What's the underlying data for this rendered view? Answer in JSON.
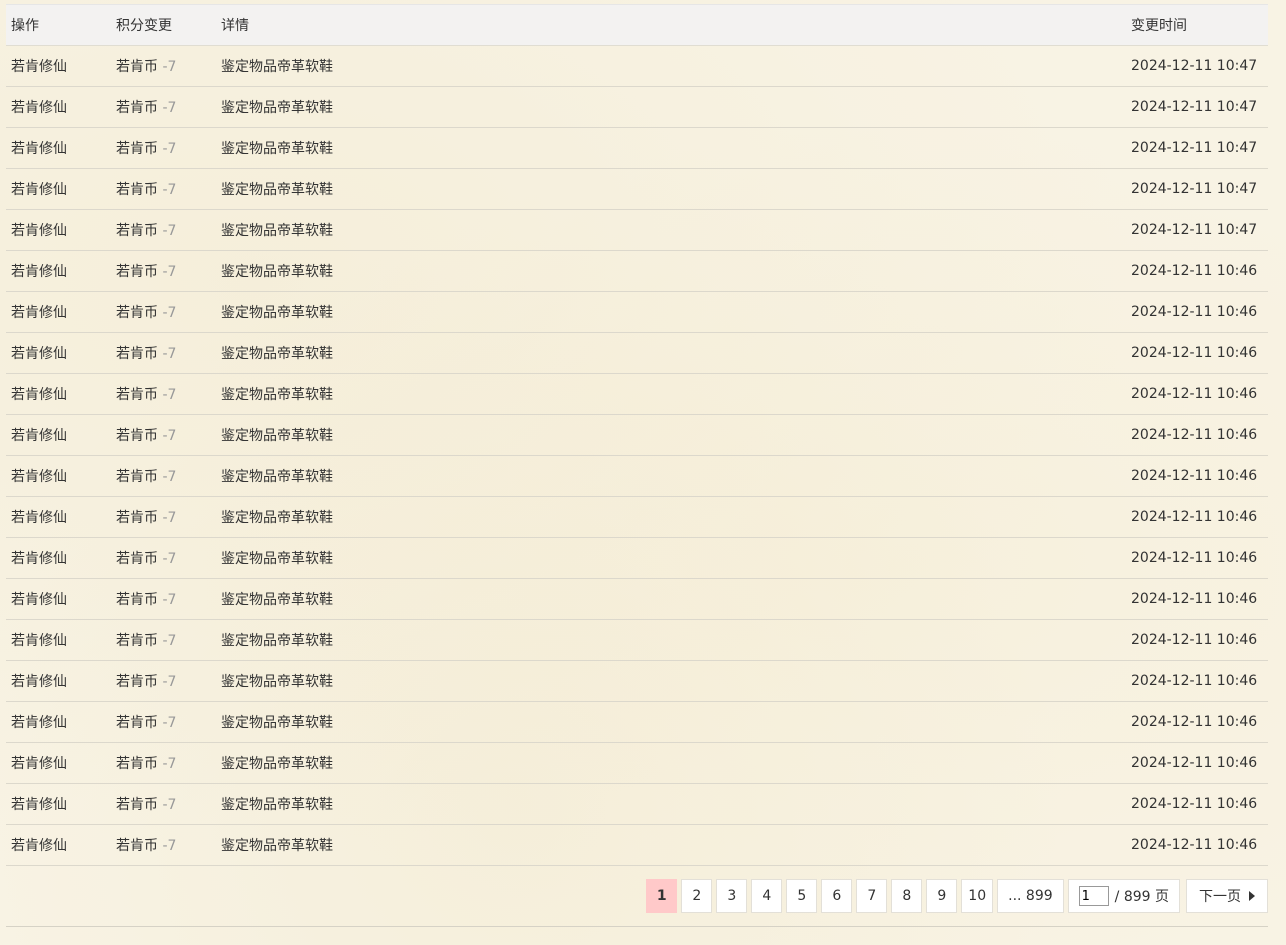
{
  "table": {
    "headers": {
      "op": "操作",
      "change": "积分变更",
      "detail": "详情",
      "time": "变更时间"
    },
    "rows": [
      {
        "op": "若肯修仙",
        "currency": "若肯币",
        "delta": "-7",
        "detail": "鉴定物品帝革软鞋",
        "time": "2024-12-11 10:47"
      },
      {
        "op": "若肯修仙",
        "currency": "若肯币",
        "delta": "-7",
        "detail": "鉴定物品帝革软鞋",
        "time": "2024-12-11 10:47"
      },
      {
        "op": "若肯修仙",
        "currency": "若肯币",
        "delta": "-7",
        "detail": "鉴定物品帝革软鞋",
        "time": "2024-12-11 10:47"
      },
      {
        "op": "若肯修仙",
        "currency": "若肯币",
        "delta": "-7",
        "detail": "鉴定物品帝革软鞋",
        "time": "2024-12-11 10:47"
      },
      {
        "op": "若肯修仙",
        "currency": "若肯币",
        "delta": "-7",
        "detail": "鉴定物品帝革软鞋",
        "time": "2024-12-11 10:47"
      },
      {
        "op": "若肯修仙",
        "currency": "若肯币",
        "delta": "-7",
        "detail": "鉴定物品帝革软鞋",
        "time": "2024-12-11 10:46"
      },
      {
        "op": "若肯修仙",
        "currency": "若肯币",
        "delta": "-7",
        "detail": "鉴定物品帝革软鞋",
        "time": "2024-12-11 10:46"
      },
      {
        "op": "若肯修仙",
        "currency": "若肯币",
        "delta": "-7",
        "detail": "鉴定物品帝革软鞋",
        "time": "2024-12-11 10:46"
      },
      {
        "op": "若肯修仙",
        "currency": "若肯币",
        "delta": "-7",
        "detail": "鉴定物品帝革软鞋",
        "time": "2024-12-11 10:46"
      },
      {
        "op": "若肯修仙",
        "currency": "若肯币",
        "delta": "-7",
        "detail": "鉴定物品帝革软鞋",
        "time": "2024-12-11 10:46"
      },
      {
        "op": "若肯修仙",
        "currency": "若肯币",
        "delta": "-7",
        "detail": "鉴定物品帝革软鞋",
        "time": "2024-12-11 10:46"
      },
      {
        "op": "若肯修仙",
        "currency": "若肯币",
        "delta": "-7",
        "detail": "鉴定物品帝革软鞋",
        "time": "2024-12-11 10:46"
      },
      {
        "op": "若肯修仙",
        "currency": "若肯币",
        "delta": "-7",
        "detail": "鉴定物品帝革软鞋",
        "time": "2024-12-11 10:46"
      },
      {
        "op": "若肯修仙",
        "currency": "若肯币",
        "delta": "-7",
        "detail": "鉴定物品帝革软鞋",
        "time": "2024-12-11 10:46"
      },
      {
        "op": "若肯修仙",
        "currency": "若肯币",
        "delta": "-7",
        "detail": "鉴定物品帝革软鞋",
        "time": "2024-12-11 10:46"
      },
      {
        "op": "若肯修仙",
        "currency": "若肯币",
        "delta": "-7",
        "detail": "鉴定物品帝革软鞋",
        "time": "2024-12-11 10:46"
      },
      {
        "op": "若肯修仙",
        "currency": "若肯币",
        "delta": "-7",
        "detail": "鉴定物品帝革软鞋",
        "time": "2024-12-11 10:46"
      },
      {
        "op": "若肯修仙",
        "currency": "若肯币",
        "delta": "-7",
        "detail": "鉴定物品帝革软鞋",
        "time": "2024-12-11 10:46"
      },
      {
        "op": "若肯修仙",
        "currency": "若肯币",
        "delta": "-7",
        "detail": "鉴定物品帝革软鞋",
        "time": "2024-12-11 10:46"
      },
      {
        "op": "若肯修仙",
        "currency": "若肯币",
        "delta": "-7",
        "detail": "鉴定物品帝革软鞋",
        "time": "2024-12-11 10:46"
      }
    ]
  },
  "pagination": {
    "current_page": "1",
    "pages": [
      "2",
      "3",
      "4",
      "5",
      "6",
      "7",
      "8",
      "9",
      "10"
    ],
    "last_page_label": "... 899",
    "jump_value": "1",
    "total_label": "/ 899 页",
    "next_label": "下一页"
  },
  "colors": {
    "current_page_bg": "#ffc9c9",
    "page_background": "#f8f3e4",
    "delta_text": "#999999"
  }
}
